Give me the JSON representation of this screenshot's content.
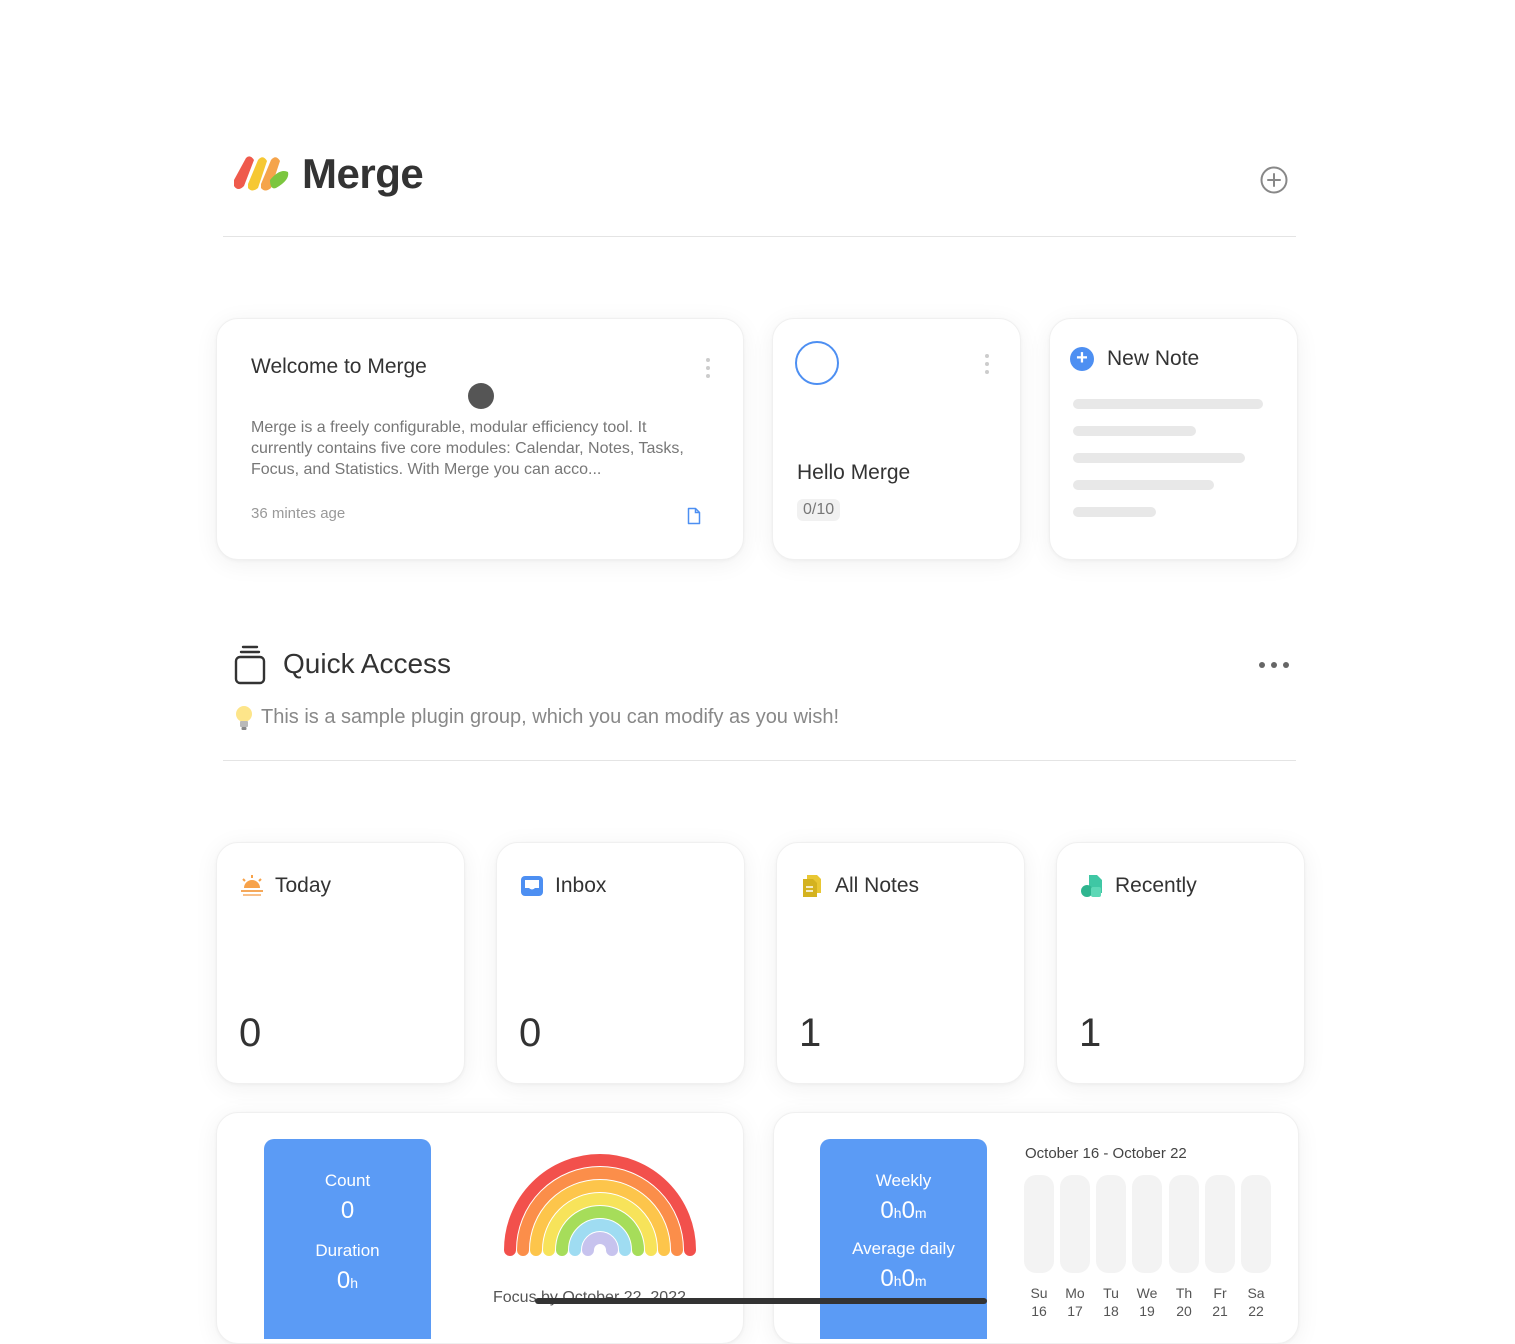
{
  "app": {
    "title": "Merge"
  },
  "notes": {
    "welcome": {
      "title": "Welcome to Merge",
      "description": "Merge is a freely configurable, modular efficiency tool. It currently contains five core modules: Calendar, Notes, Tasks, Focus, and Statistics. With Merge you can acco...",
      "time": "36 mintes age"
    },
    "task": {
      "title": "Hello Merge",
      "progress": "0/10"
    },
    "new_note": {
      "label": "New Note"
    }
  },
  "quick_access": {
    "title": "Quick Access",
    "hint": "This is a sample plugin group, which you can modify as you wish!",
    "items": [
      {
        "label": "Today",
        "count": "0",
        "icon": "sunrise-icon"
      },
      {
        "label": "Inbox",
        "count": "0",
        "icon": "inbox-icon"
      },
      {
        "label": "All Notes",
        "count": "1",
        "icon": "documents-icon"
      },
      {
        "label": "Recently",
        "count": "1",
        "icon": "recent-shapes-icon"
      }
    ]
  },
  "focus": {
    "count_label": "Count",
    "count_value": "0",
    "duration_label": "Duration",
    "duration_value": "0",
    "duration_unit": "h",
    "caption": "Focus by October 22, 2022"
  },
  "weekly": {
    "weekly_label": "Weekly",
    "weekly_h": "0",
    "weekly_m": "0",
    "avg_label": "Average daily",
    "avg_h": "0",
    "avg_m": "0",
    "unit_h": "h",
    "unit_m": "m",
    "range": "October 16 - October 22",
    "days": [
      "Su",
      "Mo",
      "Tu",
      "We",
      "Th",
      "Fr",
      "Sa"
    ],
    "dates": [
      "16",
      "17",
      "18",
      "19",
      "20",
      "21",
      "22"
    ]
  },
  "colors": {
    "accent": "#5b9bf5",
    "text": "#333333",
    "muted": "#888888"
  }
}
